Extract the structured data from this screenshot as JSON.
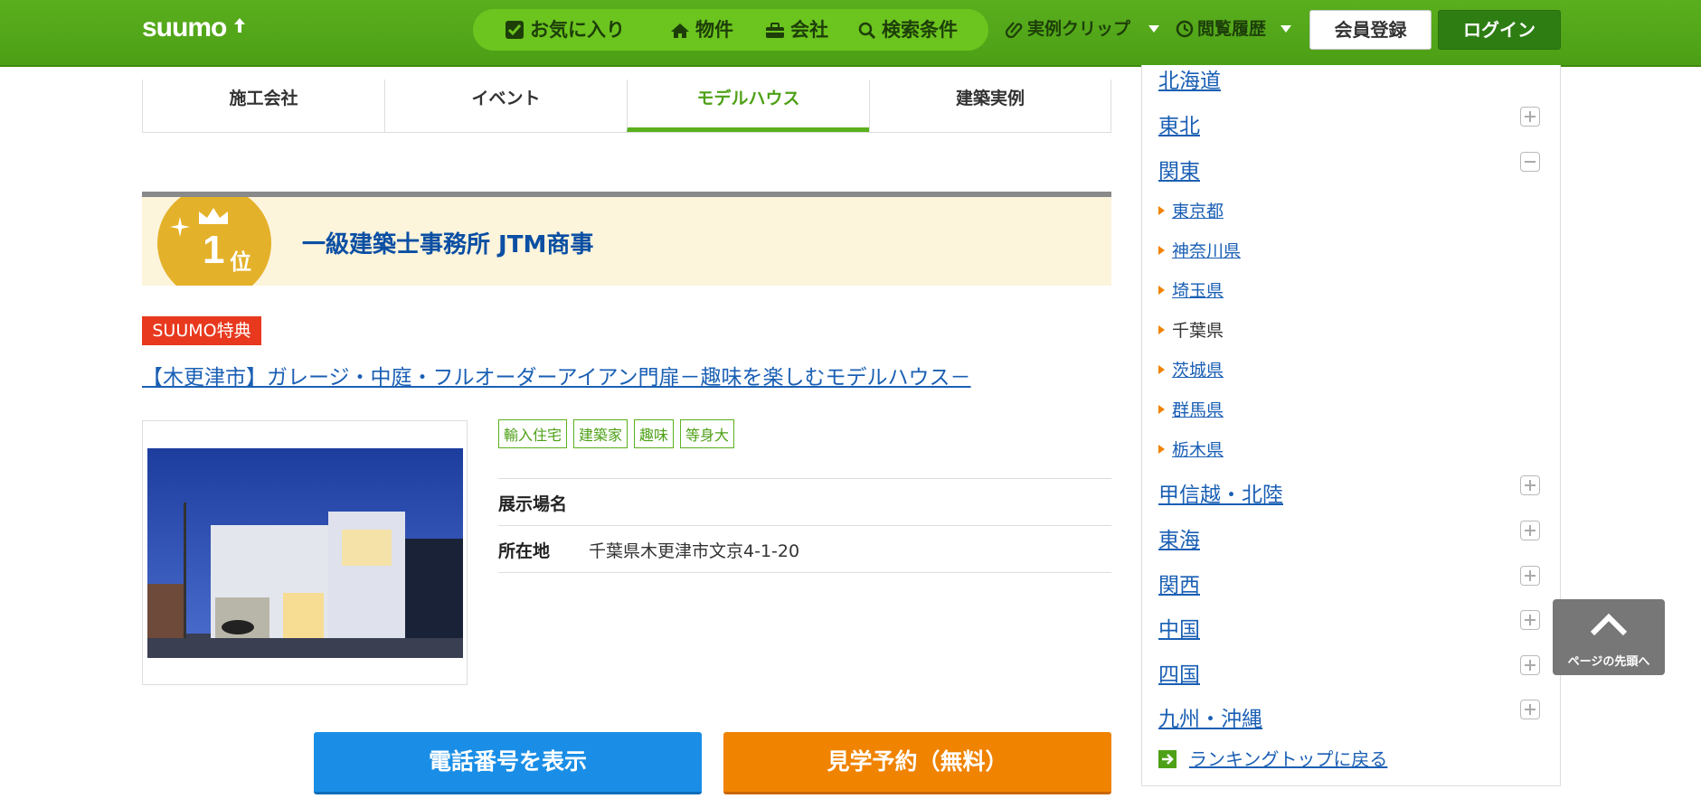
{
  "header": {
    "logo_text": "suumo",
    "nav": [
      {
        "label": "お気に入り",
        "icon": "checkbox-icon"
      },
      {
        "label": "物件",
        "icon": "house-icon"
      },
      {
        "label": "会社",
        "icon": "briefcase-icon"
      },
      {
        "label": "検索条件",
        "icon": "search-icon"
      }
    ],
    "clip_label": "実例クリップ",
    "history_label": "閲覧履歴",
    "register_label": "会員登録",
    "login_label": "ログイン"
  },
  "tabs": [
    {
      "label": "施工会社",
      "active": false
    },
    {
      "label": "イベント",
      "active": false
    },
    {
      "label": "モデルハウス",
      "active": true
    },
    {
      "label": "建築実例",
      "active": false
    }
  ],
  "ranking": {
    "rank_number": "1",
    "rank_unit": "位",
    "company": "一級建築士事務所 JTM商事"
  },
  "special_badge": "SUUMO特典",
  "model_house_link": "【木更津市】ガレージ・中庭・フルオーダーアイアン門扉－趣味を楽しむモデルハウス－",
  "tags": [
    "輸入住宅",
    "建築家",
    "趣味",
    "等身大"
  ],
  "info": {
    "venue_label": "展示場名",
    "venue_value": "",
    "address_label": "所在地",
    "address_value": "千葉県木更津市文京4-1-20"
  },
  "buttons": {
    "phone": "電話番号を表示",
    "visit": "見学予約（無料）"
  },
  "sidebar": {
    "regions_top": [
      {
        "label": "北海道",
        "toggle": "none"
      },
      {
        "label": "東北",
        "toggle": "plus"
      },
      {
        "label": "関東",
        "toggle": "minus"
      }
    ],
    "prefectures": [
      {
        "label": "東京都",
        "link": true
      },
      {
        "label": "神奈川県",
        "link": true
      },
      {
        "label": "埼玉県",
        "link": true
      },
      {
        "label": "千葉県",
        "link": false
      },
      {
        "label": "茨城県",
        "link": true
      },
      {
        "label": "群馬県",
        "link": true
      },
      {
        "label": "栃木県",
        "link": true
      }
    ],
    "regions_bottom": [
      {
        "label": "甲信越・北陸",
        "toggle": "plus"
      },
      {
        "label": "東海",
        "toggle": "plus"
      },
      {
        "label": "関西",
        "toggle": "plus"
      },
      {
        "label": "中国",
        "toggle": "plus"
      },
      {
        "label": "四国",
        "toggle": "plus"
      },
      {
        "label": "九州・沖縄",
        "toggle": "plus"
      }
    ],
    "back_link": "ランキングトップに戻る"
  },
  "page_top_label": "ページの先頭へ",
  "colors": {
    "header_green": "#5aaf1e",
    "accent_green": "#4ea117",
    "link_blue": "#1a5fb4",
    "special_red": "#e8391e",
    "phone_blue": "#1a8ee6",
    "visit_orange": "#f08300"
  }
}
